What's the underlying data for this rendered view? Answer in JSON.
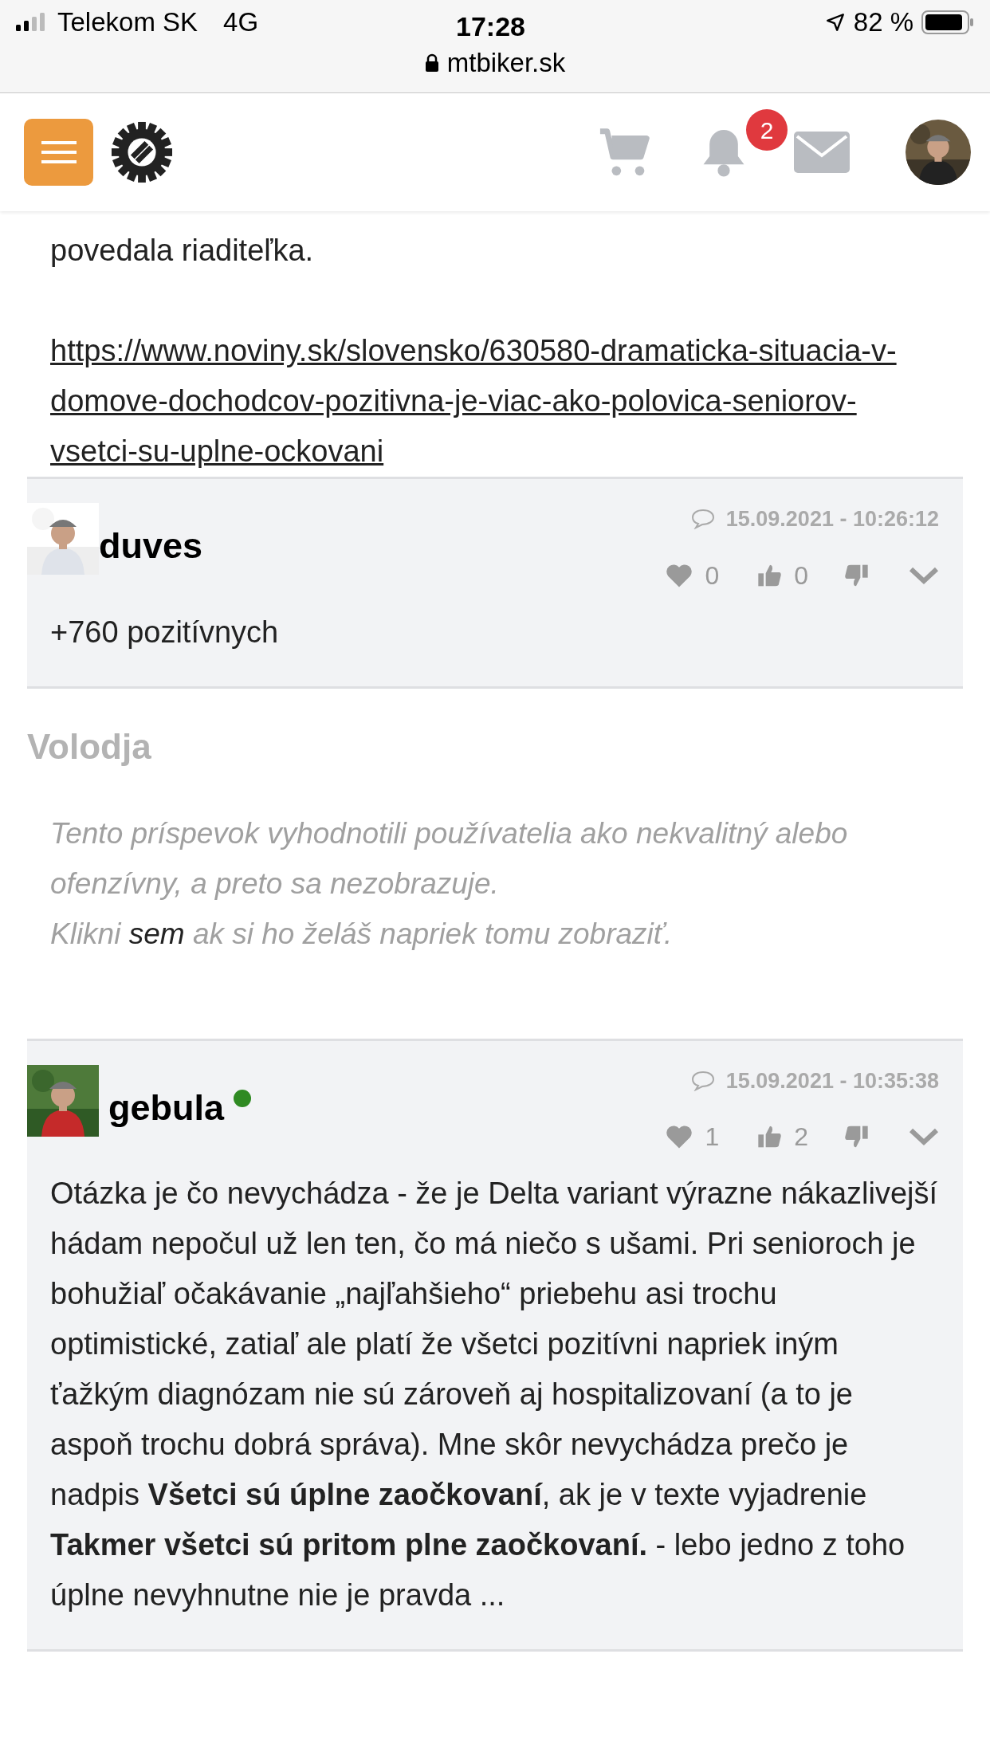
{
  "status_bar": {
    "carrier": "Telekom SK",
    "network": "4G",
    "time": "17:28",
    "battery": "82 %"
  },
  "address_bar": {
    "url": "mtbiker.sk"
  },
  "header": {
    "notification_count": "2"
  },
  "article": {
    "paragraph": "povedala riaditeľka.",
    "link": "https://www.noviny.sk/slovensko/630580-dramaticka-situacia-v-domove-dochodcov-pozitivna-je-viac-ako-polovica-seniorov-vsetci-su-uplne-ockovani"
  },
  "posts": [
    {
      "kind": "post",
      "author": "duves",
      "online": false,
      "timestamp": "15.09.2021 - 10:26:12",
      "likes": "0",
      "thumbs_up": "0",
      "body": "+760 pozitívnych"
    },
    {
      "kind": "hidden",
      "author": "Volodja",
      "notice": "Tento príspevok vyhodnotili používatelia ako nekvalitný alebo ofenzívny, a preto sa nezobrazuje.",
      "click_before": "Klikni",
      "click_link": "sem",
      "click_after": "ak si ho želáš napriek tomu zobraziť."
    },
    {
      "kind": "post",
      "author": "gebula",
      "online": true,
      "timestamp": "15.09.2021 - 10:35:38",
      "likes": "1",
      "thumbs_up": "2",
      "body": "Otázka je čo nevychádza - že je Delta variant výrazne nákazlivejší hádam nepočul už len ten, čo má niečo s ušami. Pri senioroch je bohužiaľ očakávanie „najľahšieho“ priebehu asi trochu optimistické, zatiaľ ale platí že všetci pozitívni napriek iným ťažkým diagnózam nie sú zároveň aj hospitalizovaní (a to je aspoň trochu dobrá správa). Mne skôr nevychádza prečo je nadpis **Všetci sú úplne zaočkovaní**, ak je v texte vyjadrenie **Takmer všetci sú pritom plne zaočkovaní.** - lebo jedno z toho úplne nevyhnutne nie je pravda ..."
    }
  ]
}
